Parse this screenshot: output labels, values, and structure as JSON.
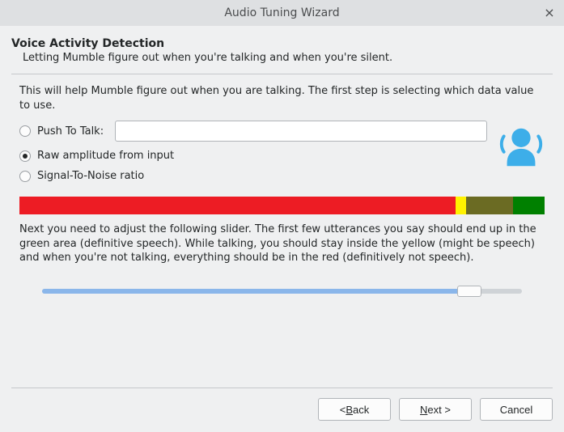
{
  "window": {
    "title": "Audio Tuning Wizard"
  },
  "page": {
    "title": "Voice Activity Detection",
    "subtitle": "Letting Mumble figure out when you're talking and when you're silent.",
    "intro": "This will help Mumble figure out when you are talking. The first step is selecting which data value to use.",
    "slider_help": "Next you need to adjust the following slider. The first few utterances you say should end up in the green area (definitive speech). While talking, you should stay inside the yellow (might be speech) and when you're not talking, everything should be in the red (definitively not speech)."
  },
  "options": {
    "ptt_label": "Push To Talk:",
    "ptt_value": "",
    "raw_label": "Raw amplitude from input",
    "snr_label": "Signal-To-Noise ratio",
    "selected": "raw"
  },
  "meter": {
    "red_pct": 83,
    "yellow_pct": 2,
    "olive_pct": 9,
    "green_pct": 6
  },
  "slider": {
    "value_pct": 89
  },
  "buttons": {
    "back_prefix": "< ",
    "back_mnemonic": "B",
    "back_rest": "ack",
    "next_mnemonic": "N",
    "next_rest": "ext >",
    "cancel": "Cancel"
  },
  "colors": {
    "accent_blue": "#3daee9"
  }
}
